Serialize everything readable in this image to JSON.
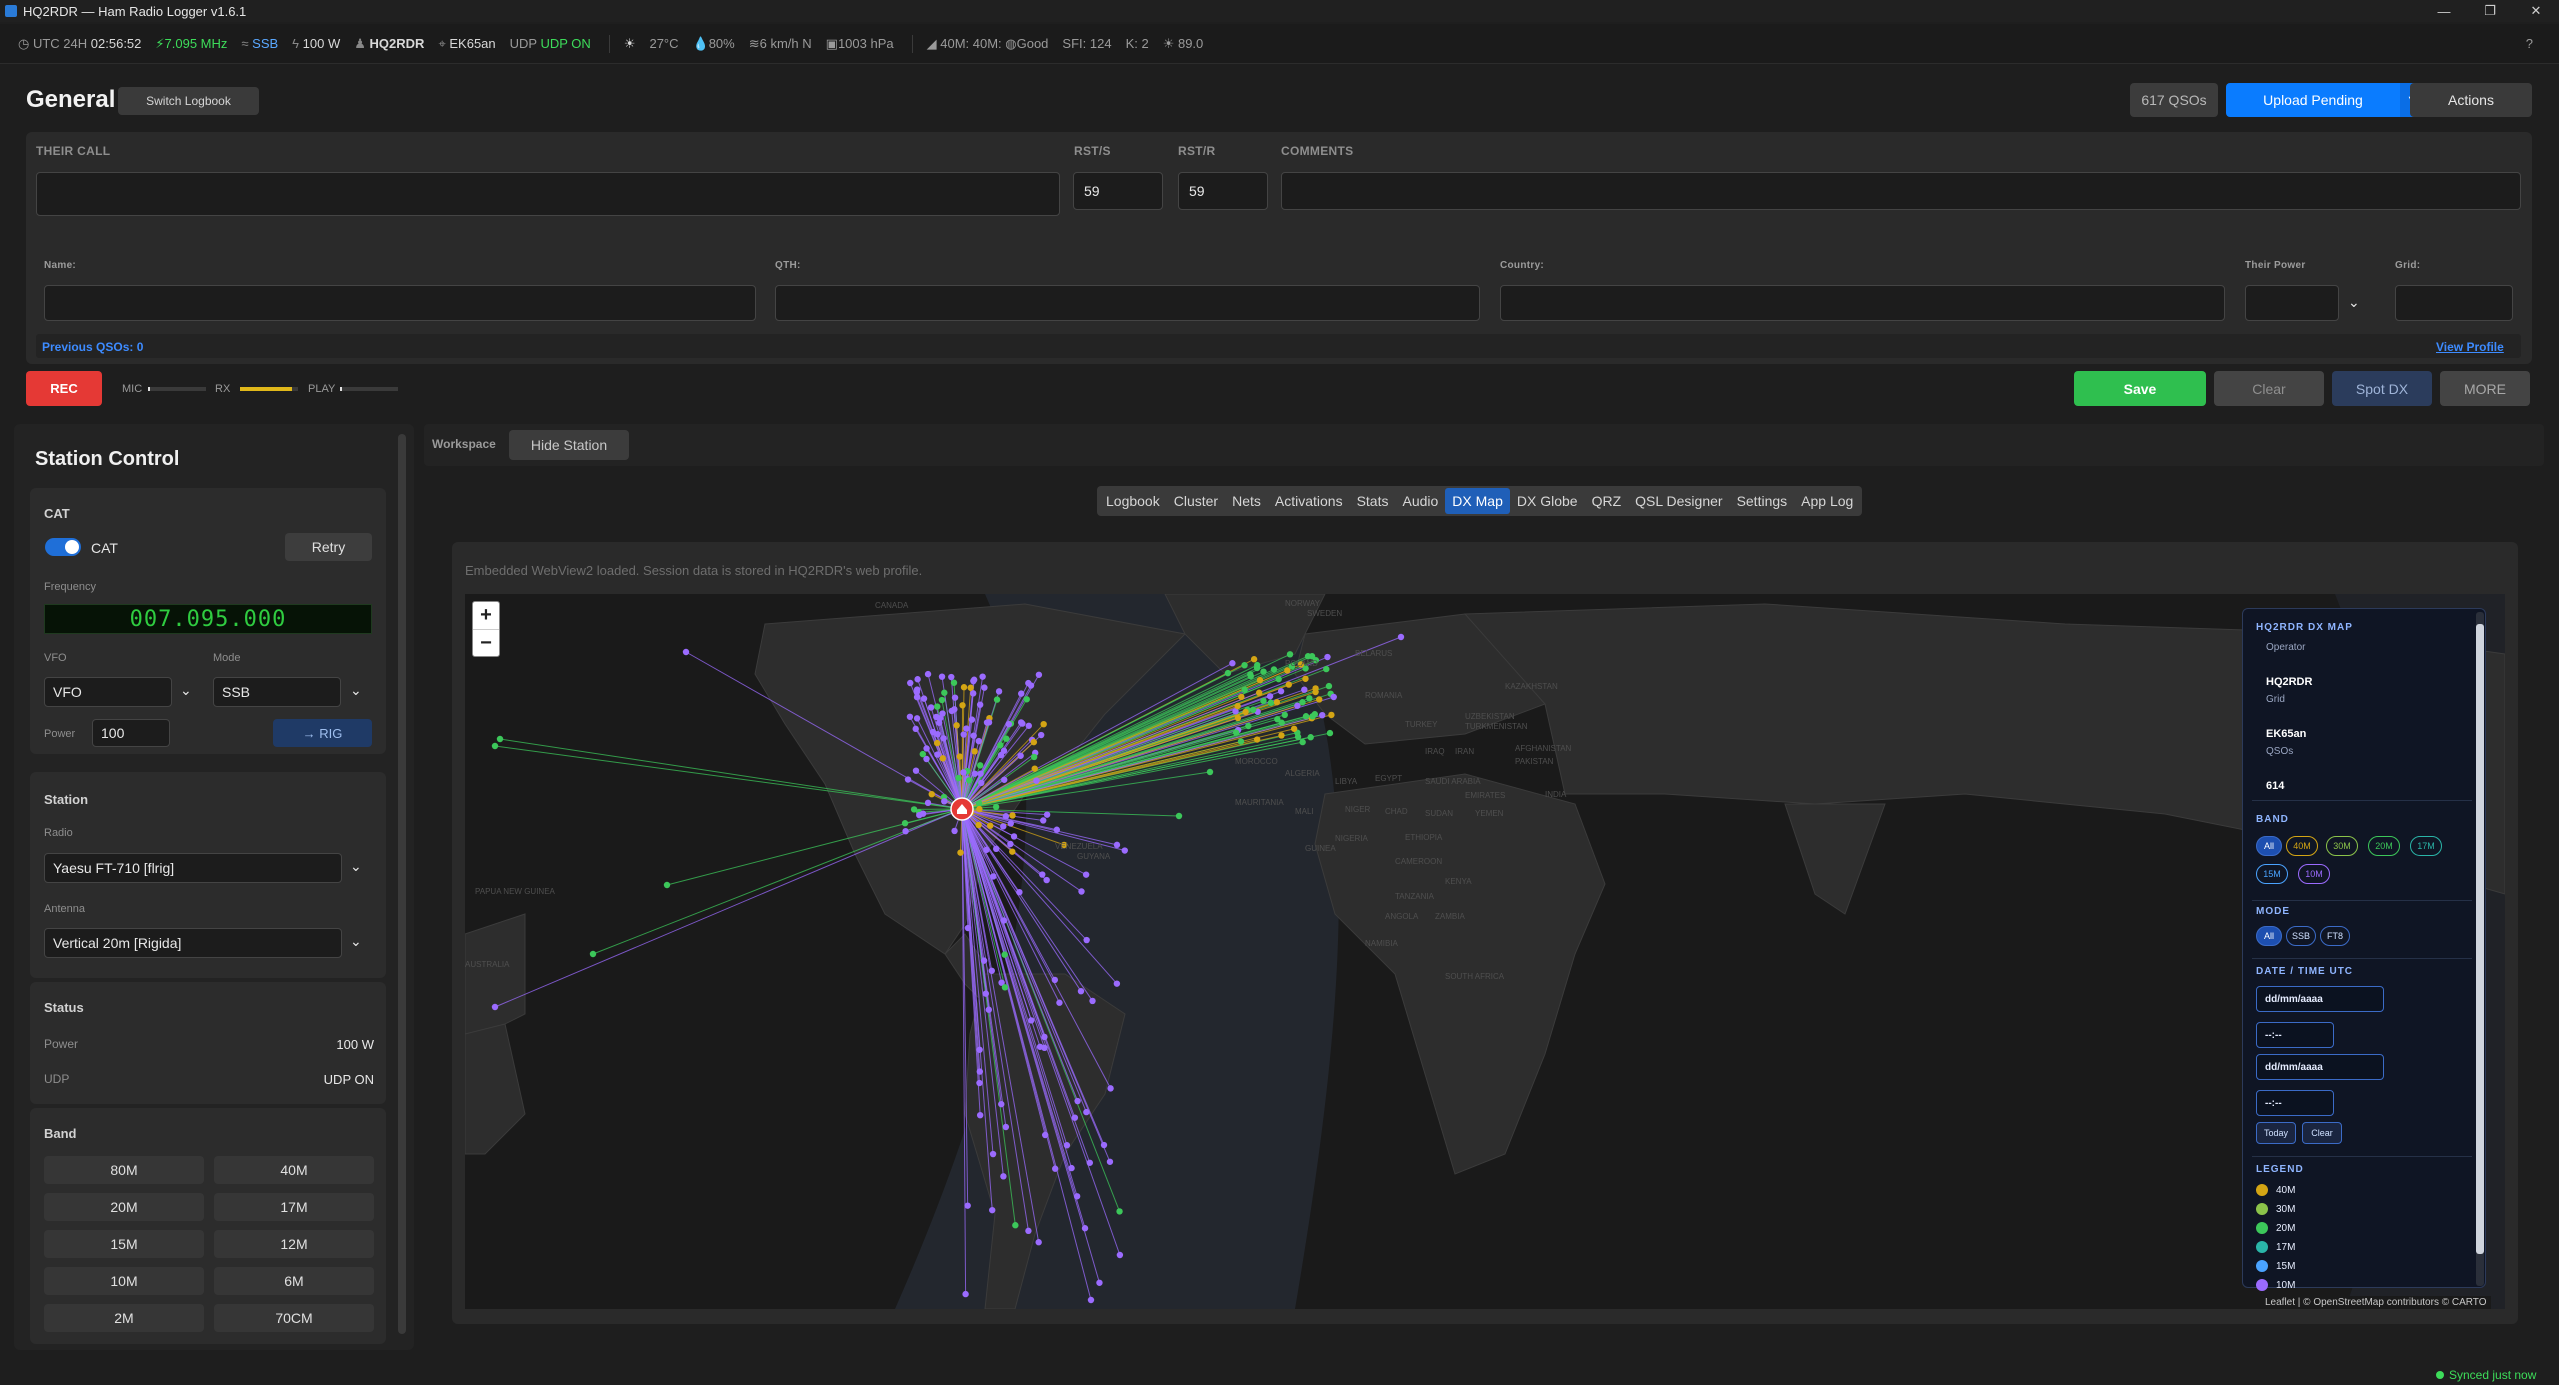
{
  "window": {
    "title": "HQ2RDR — Ham Radio Logger  v1.6.1",
    "min": "—",
    "max": "❐",
    "close": "✕"
  },
  "statusbar": {
    "utc_label": "UTC 24H",
    "utc_time": "02:56:52",
    "freq": "7.095 MHz",
    "mode": "SSB",
    "power": "100 W",
    "callsign": "HQ2RDR",
    "grid": "EK65an",
    "udp_label": "UDP",
    "udp_value": "UDP ON",
    "temp": "27°C",
    "humidity": "80%",
    "wind": "6 km/h N",
    "pressure": "1003 hPa",
    "bands": "40M: 40M: ",
    "bands_cond": "Good",
    "sfi": "SFI: 124",
    "k": "K: 2",
    "flux": "89.0",
    "help": "?"
  },
  "header": {
    "title": "General",
    "switch_logbook": "Switch Logbook",
    "qso_count": "617 QSOs",
    "upload_pending": "Upload Pending",
    "actions": "Actions"
  },
  "form": {
    "their_call_label": "THEIR CALL",
    "their_call_value": "",
    "rsts_label": "RST/S",
    "rsts_value": "59",
    "rstr_label": "RST/R",
    "rstr_value": "59",
    "comments_label": "COMMENTS",
    "name_label": "Name:",
    "qth_label": "QTH:",
    "country_label": "Country:",
    "their_power_label": "Their Power",
    "grid_label": "Grid:",
    "previous_qsos": "Previous QSOs: 0",
    "view_profile": "View Profile"
  },
  "recorder": {
    "rec": "REC",
    "mic": "MIC",
    "rx": "RX",
    "play": "PLAY",
    "mic_level": 0.04,
    "rx_level": 0.9,
    "play_level": 0.03
  },
  "actions": {
    "save": "Save",
    "clear": "Clear",
    "spot_dx": "Spot DX",
    "more": "MORE"
  },
  "station_control": {
    "title": "Station Control",
    "cat_title": "CAT",
    "cat_toggle_label": "CAT",
    "cat_on": true,
    "retry": "Retry",
    "frequency_label": "Frequency",
    "frequency_display": "007.095.000",
    "vfo_label": "VFO",
    "vfo_value": "VFO",
    "mode_label": "Mode",
    "mode_value": "SSB",
    "power_label": "Power",
    "power_value": "100",
    "to_rig": "→ RIG",
    "station_title": "Station",
    "radio_label": "Radio",
    "radio_value": "Yaesu FT-710 [flrig]",
    "antenna_label": "Antenna",
    "antenna_value": "Vertical 20m [Rigida]",
    "status_title": "Status",
    "status_power_label": "Power",
    "status_power_value": "100 W",
    "status_udp_label": "UDP",
    "status_udp_value": "UDP ON",
    "band_title": "Band",
    "bands": [
      "80M",
      "40M",
      "20M",
      "17M",
      "15M",
      "12M",
      "10M",
      "6M",
      "2M",
      "70CM"
    ]
  },
  "workspace": {
    "label": "Workspace",
    "hide_station": "Hide Station",
    "tabs": [
      "Logbook",
      "Cluster",
      "Nets",
      "Activations",
      "Stats",
      "Audio",
      "DX Map",
      "DX Globe",
      "QRZ",
      "QSL Designer",
      "Settings",
      "App Log"
    ],
    "active_tab": "DX Map",
    "webview_note": "Embedded WebView2 loaded. Session data is stored in HQ2RDR's web profile."
  },
  "map": {
    "zoom_in": "+",
    "zoom_out": "−",
    "labels": [
      "CANADA",
      "NORWAY",
      "SWEDEN",
      "BELARUS",
      "POLAND",
      "ROMANIA",
      "KAZAKHSTAN",
      "UZBEKISTAN",
      "TURKMENISTAN",
      "TURKEY",
      "IRAQ",
      "IRAN",
      "AFGHANISTAN",
      "PAKISTAN",
      "MOROCCO",
      "ALGERIA",
      "LIBYA",
      "EGYPT",
      "SAUDI ARABIA",
      "EMIRATES",
      "INDIA",
      "MAURITANIA",
      "MALI",
      "NIGER",
      "CHAD",
      "SUDAN",
      "YEMEN",
      "ETHIOPIA",
      "NIGERIA",
      "GUINEA",
      "CAMEROON",
      "KENYA",
      "TANZANIA",
      "ANGOLA",
      "ZAMBIA",
      "NAMIBIA",
      "SOUTH AFRICA",
      "VENEZUELA",
      "GUYANA",
      "PAPUA NEW GUINEA",
      "AUSTRALIA"
    ],
    "attribution": "Leaflet | © OpenStreetMap contributors © CARTO",
    "home_lat": 14.1,
    "home_lon": -87.2
  },
  "dx_panel": {
    "title": "HQ2RDR DX MAP",
    "operator_label": "Operator",
    "operator_value": "HQ2RDR",
    "grid_label": "Grid",
    "grid_value": "EK65an",
    "qsos_label": "QSOs",
    "qsos_value": "614",
    "band_title": "BAND",
    "band_pills": [
      "All",
      "40M",
      "30M",
      "20M",
      "17M",
      "15M",
      "10M"
    ],
    "mode_title": "MODE",
    "mode_pills": [
      "All",
      "SSB",
      "FT8"
    ],
    "date_title": "DATE / TIME UTC",
    "date_from": "dd/mm/aaaa",
    "time_from": "--:--",
    "date_to": "dd/mm/aaaa",
    "time_to": "--:--",
    "today": "Today",
    "clear": "Clear",
    "legend_title": "LEGEND",
    "legend": [
      {
        "band": "40M",
        "color": "#d4a514"
      },
      {
        "band": "30M",
        "color": "#8bc34a"
      },
      {
        "band": "20M",
        "color": "#3cc75a"
      },
      {
        "band": "17M",
        "color": "#2ab5a8"
      },
      {
        "band": "15M",
        "color": "#4aa3ff"
      },
      {
        "band": "10M",
        "color": "#9b6bff"
      }
    ]
  },
  "footer": {
    "synced": "Synced just now"
  },
  "colors": {
    "accent": "#0a7cff",
    "save": "#2fbf4f",
    "rec": "#e53935",
    "link": "#3d8bff",
    "qso_40m": "#d4a514",
    "qso_20m": "#3cc75a",
    "qso_10m": "#9b6bff"
  }
}
